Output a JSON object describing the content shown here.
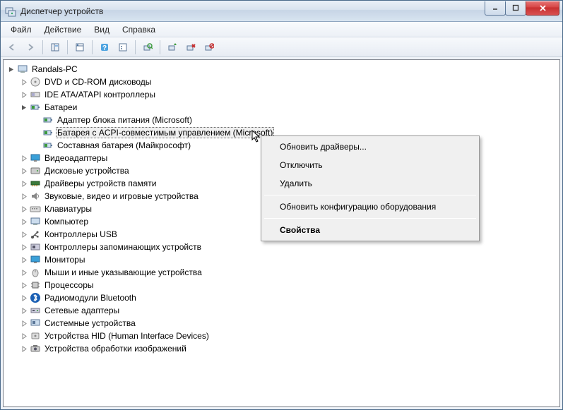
{
  "window": {
    "title": "Диспетчер устройств"
  },
  "menu": {
    "file": "Файл",
    "action": "Действие",
    "view": "Вид",
    "help": "Справка"
  },
  "tree": {
    "root": "Randals-PC",
    "cat": {
      "dvd": "DVD и CD-ROM дисководы",
      "ide": "IDE ATA/ATAPI контроллеры",
      "batteries": "Батареи",
      "bat_items": {
        "adapter": "Адаптер блока питания (Microsoft)",
        "acpi": "Батарея с ACPI-совместимым управлением (Microsoft)",
        "composite": "Составная батарея (Майкрософт)"
      },
      "video": "Видеоадаптеры",
      "disk": "Дисковые устройства",
      "memdrv": "Драйверы устройств памяти",
      "sound": "Звуковые, видео и игровые устройства",
      "keyboard": "Клавиатуры",
      "computer": "Компьютер",
      "usb": "Контроллеры USB",
      "storage": "Контроллеры запоминающих устройств",
      "monitors": "Мониторы",
      "mice": "Мыши и иные указывающие устройства",
      "cpu": "Процессоры",
      "bluetooth": "Радиомодули Bluetooth",
      "network": "Сетевые адаптеры",
      "system": "Системные устройства",
      "hid": "Устройства HID (Human Interface Devices)",
      "imaging": "Устройства обработки изображений"
    }
  },
  "context": {
    "update": "Обновить драйверы...",
    "disable": "Отключить",
    "delete": "Удалить",
    "scan": "Обновить конфигурацию оборудования",
    "properties": "Свойства"
  }
}
